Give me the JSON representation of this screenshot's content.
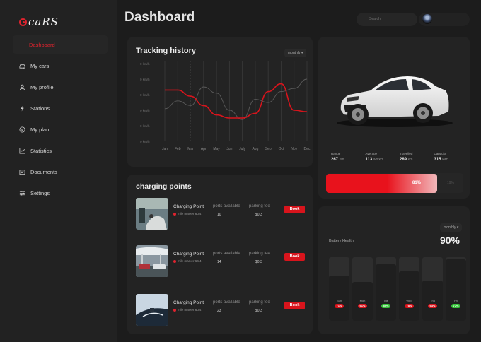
{
  "brand": {
    "logo_text": "caRS",
    "accent": "#e0232e"
  },
  "sidebar": {
    "items": [
      {
        "label": "Dashboard",
        "icon": "dashboard-icon",
        "active": true
      },
      {
        "label": "My cars",
        "icon": "car-icon"
      },
      {
        "label": "My profile",
        "icon": "user-icon"
      },
      {
        "label": "Stations",
        "icon": "bolt-icon"
      },
      {
        "label": "My plan",
        "icon": "plan-icon"
      },
      {
        "label": "Statistics",
        "icon": "chart-icon"
      },
      {
        "label": "Documents",
        "icon": "document-icon"
      },
      {
        "label": "Settings",
        "icon": "sliders-icon"
      }
    ]
  },
  "header": {
    "title": "Dashboard",
    "search_placeholder": "Search"
  },
  "tracking": {
    "title": "Tracking history",
    "filter": "monthly",
    "chart_data": {
      "type": "line",
      "categories": [
        "Jan",
        "Feb",
        "Mar",
        "Apr",
        "May",
        "Jun",
        "July",
        "Aug",
        "Sep",
        "Oct",
        "Nov",
        "Dec"
      ],
      "y_ticks": [
        "0 km/h",
        "0 km/h",
        "0 km/h",
        "0 km/h",
        "0 km/h",
        "0 km/h"
      ],
      "ylim": [
        0,
        5
      ],
      "series": [
        {
          "color": "#d8141c",
          "values": [
            3.3,
            3.3,
            2.9,
            2.3,
            1.7,
            1.5,
            1.5,
            1.8,
            3.2,
            3.7,
            2.0,
            1.9
          ]
        },
        {
          "color": "#5a5a5a",
          "values": [
            2.1,
            2.6,
            2.3,
            3.5,
            3.1,
            2.0,
            1.4,
            2.7,
            2.5,
            3.2,
            3.4,
            4.0
          ]
        }
      ]
    }
  },
  "charging": {
    "title": "charging points",
    "col_ports": "ports available",
    "col_fee": "parking fee",
    "book_label": "Book",
    "rows": [
      {
        "name": "Charging Point",
        "sub": "mile marker 60/4",
        "ports": "10",
        "fee": "$0.3"
      },
      {
        "name": "Charging Point",
        "sub": "mile marker 60/4",
        "ports": "14",
        "fee": "$0.3"
      },
      {
        "name": "Charging Point",
        "sub": "mile marker 60/4",
        "ports": "23",
        "fee": "$0.3"
      }
    ]
  },
  "car": {
    "stats": [
      {
        "label": "Range",
        "value": "267",
        "unit": "km"
      },
      {
        "label": "Average",
        "value": "113",
        "unit": "wh/km"
      },
      {
        "label": "Travelled",
        "value": "289",
        "unit": "km"
      },
      {
        "label": "Capacity",
        "value": "315",
        "unit": "kwh"
      }
    ],
    "battery_percent": 81,
    "battery_label": "81%",
    "battery_rest_label": "19%"
  },
  "health": {
    "filter": "monthly",
    "label": "Battery Health",
    "value": "90%",
    "bars": [
      {
        "day": "Sun",
        "pct": 71,
        "label": "71%",
        "color": "#d8141c"
      },
      {
        "day": "Mon",
        "pct": 61,
        "label": "61%",
        "color": "#d8141c"
      },
      {
        "day": "Tue",
        "pct": 89,
        "label": "89%",
        "color": "#37c43a"
      },
      {
        "day": "Wed",
        "pct": 78,
        "label": "78%",
        "color": "#d8141c"
      },
      {
        "day": "Thu",
        "pct": 63,
        "label": "63%",
        "color": "#d8141c"
      },
      {
        "day": "Fri",
        "pct": 97,
        "label": "77%",
        "color": "#37c43a"
      }
    ]
  }
}
